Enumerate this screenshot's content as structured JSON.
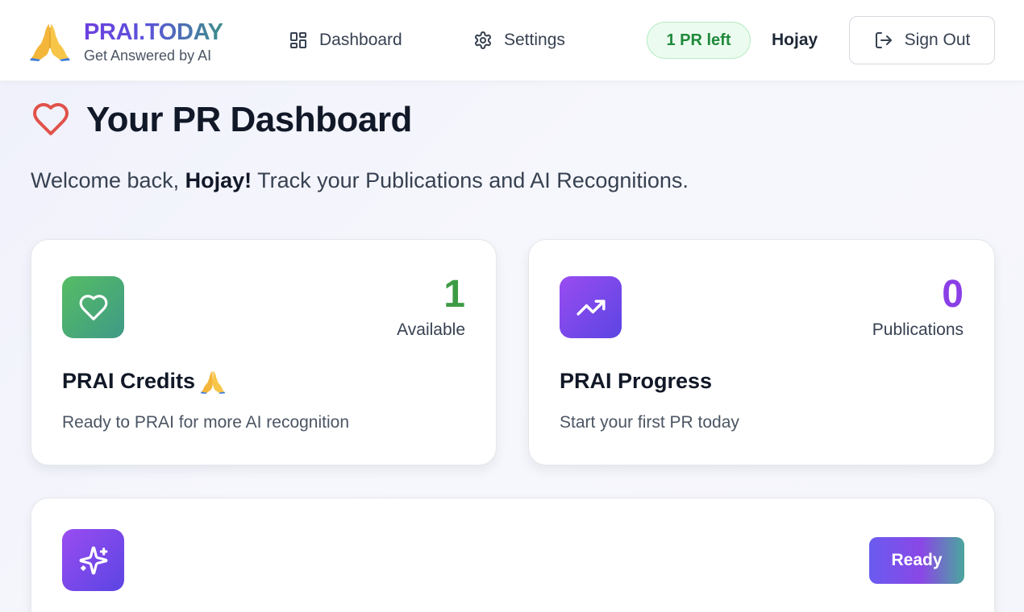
{
  "header": {
    "brand_name": "PRAI.TODAY",
    "tagline": "Get Answered by AI",
    "nav": {
      "dashboard_label": "Dashboard",
      "settings_label": "Settings"
    },
    "credits_badge": "1 PR left",
    "username": "Hojay",
    "signout_label": "Sign Out"
  },
  "main": {
    "title": "Your PR Dashboard",
    "welcome_prefix": "Welcome back, ",
    "welcome_name": "Hojay!",
    "welcome_suffix": " Track your Publications and AI Recognitions."
  },
  "cards": {
    "credits": {
      "value": "1",
      "value_label": "Available",
      "title": "PRAI Credits",
      "description": "Ready to PRAI for more AI recognition",
      "icon": "heart-icon",
      "color": "#3e9b45"
    },
    "progress": {
      "value": "0",
      "value_label": "Publications",
      "title": "PRAI Progress",
      "description": "Start your first PR today",
      "icon": "trending-up-icon",
      "color": "#8a3fe6"
    },
    "ai": {
      "icon": "sparkles-icon",
      "status_badge": "Ready"
    }
  },
  "colors": {
    "brand_purple": "#6d3fe0",
    "brand_teal": "#3e8f8a",
    "heart_red": "#e0524a",
    "success_green": "#1f8a3b"
  }
}
